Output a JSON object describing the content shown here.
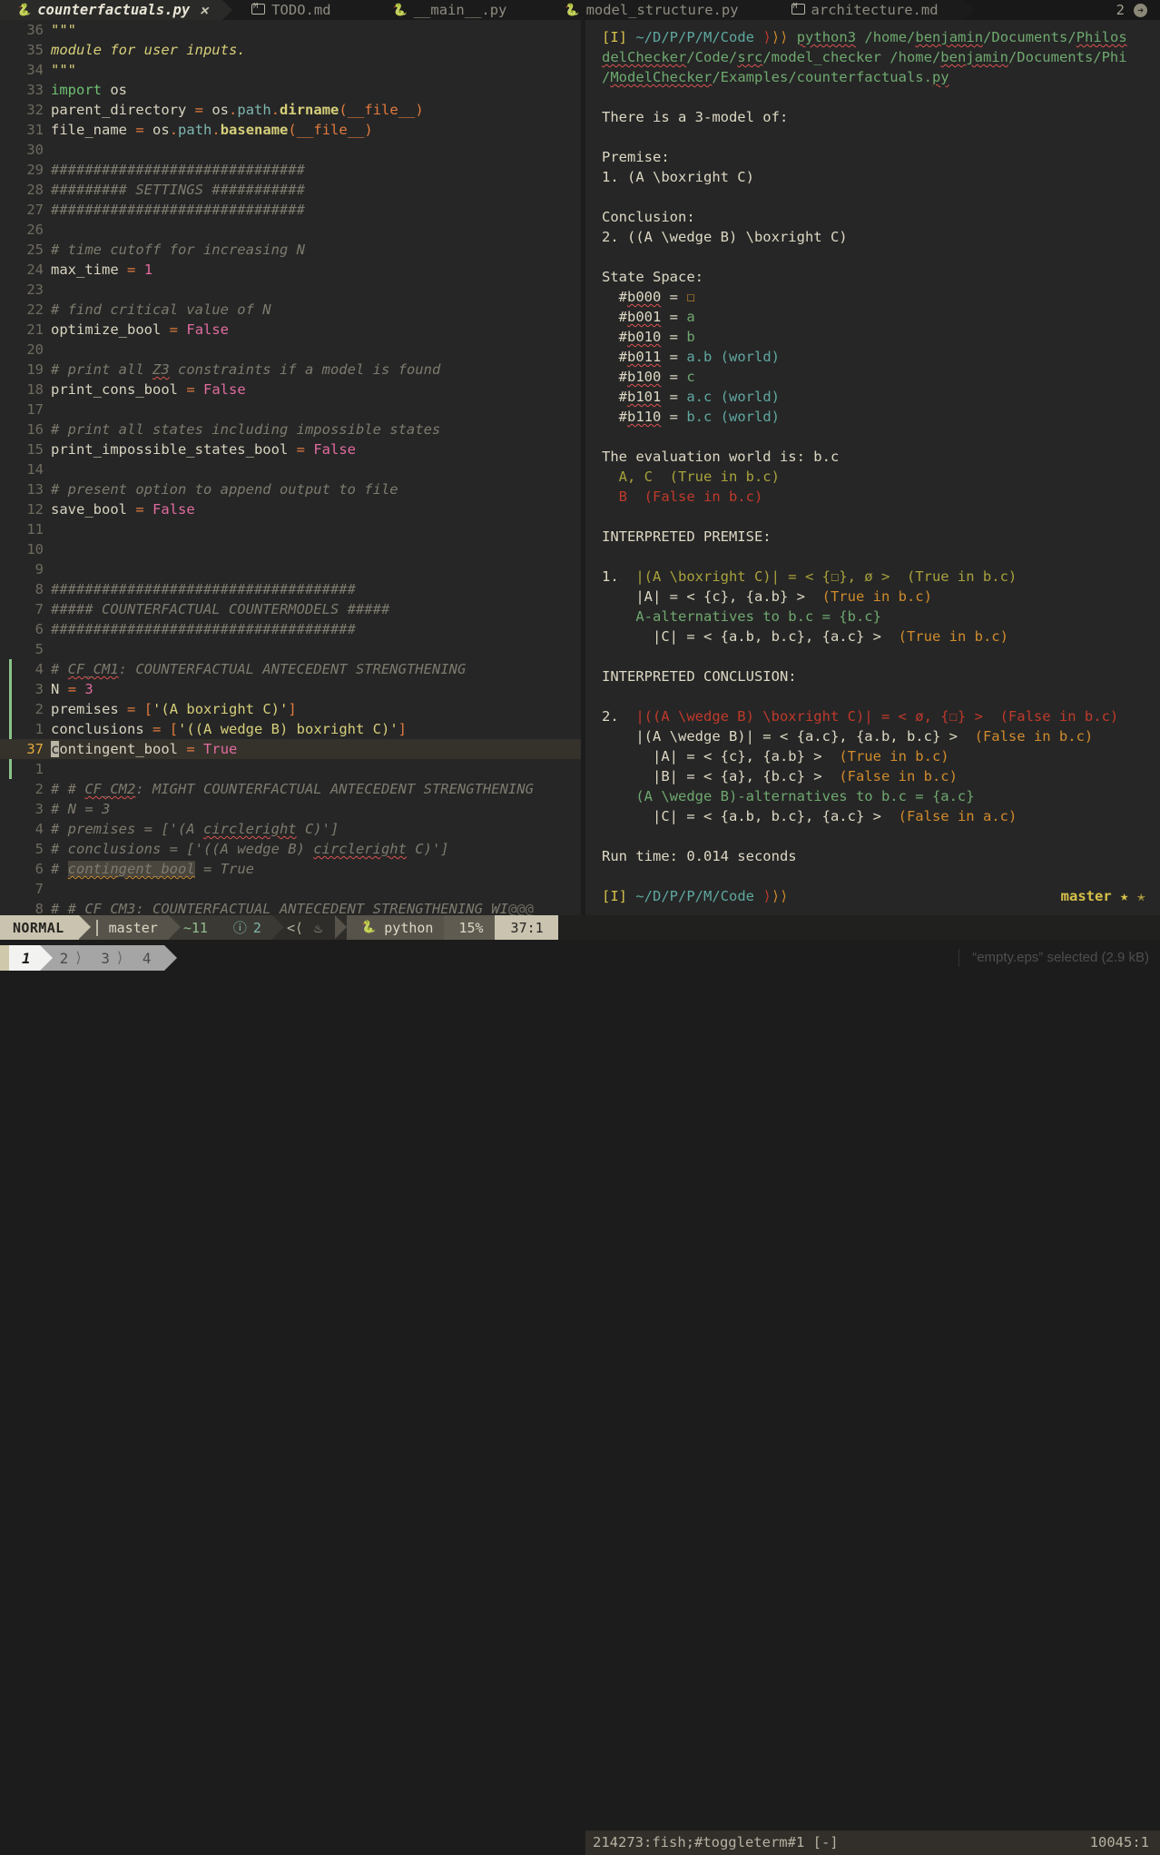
{
  "tabline": {
    "tabs": [
      {
        "label": "counterfactuals.py",
        "icon": "python-icon",
        "active": true,
        "closable": true
      },
      {
        "label": "TODO.md",
        "icon": "markdown-icon",
        "active": false
      },
      {
        "label": "__main__.py",
        "icon": "python-icon",
        "active": false
      },
      {
        "label": "model_structure.py",
        "icon": "python-icon",
        "active": false
      },
      {
        "label": "architecture.md",
        "icon": "markdown-icon",
        "active": false
      }
    ],
    "window_count": "2",
    "close_all_icon": "close-circle-icon"
  },
  "editor": {
    "lines": [
      {
        "num": "36",
        "html": "<span class=\"c-str\">\"\"\"</span>"
      },
      {
        "num": "35",
        "html": "<span class=\"c-str\" style=\"font-style:italic\">module for user inputs.</span>"
      },
      {
        "num": "34",
        "html": "<span class=\"c-str\">\"\"\"</span>"
      },
      {
        "num": "33",
        "html": "<span class=\"c-kw\">import</span> <span class=\"c-ident\">os</span>"
      },
      {
        "num": "32",
        "html": "<span class=\"c-ident\">parent_directory</span> <span class=\"c-op\">=</span> <span class=\"c-ident\">os</span><span class=\"c-op\">.</span><span class=\"c-attr\">path</span><span class=\"c-op\">.</span><span class=\"c-fn\">dirname</span><span class=\"c-brk\">(</span><span class=\"c-dunder\">__file__</span><span class=\"c-brk\">)</span>"
      },
      {
        "num": "31",
        "html": "<span class=\"c-ident\">file_name</span> <span class=\"c-op\">=</span> <span class=\"c-ident\">os</span><span class=\"c-op\">.</span><span class=\"c-attr\">path</span><span class=\"c-op\">.</span><span class=\"c-fn\">basename</span><span class=\"c-brk\">(</span><span class=\"c-dunder\">__file__</span><span class=\"c-brk\">)</span>"
      },
      {
        "num": "30",
        "html": ""
      },
      {
        "num": "29",
        "html": "<span class=\"c-comment\">##############################</span>"
      },
      {
        "num": "28",
        "html": "<span class=\"c-comment\">######### SETTINGS ###########</span>"
      },
      {
        "num": "27",
        "html": "<span class=\"c-comment\">##############################</span>"
      },
      {
        "num": "26",
        "html": ""
      },
      {
        "num": "25",
        "html": "<span class=\"c-comment\"># time cutoff for increasing N</span>"
      },
      {
        "num": "24",
        "html": "<span class=\"c-ident\">max_time</span> <span class=\"c-op\">=</span> <span class=\"c-num\">1</span>"
      },
      {
        "num": "23",
        "html": ""
      },
      {
        "num": "22",
        "html": "<span class=\"c-comment\"># find critical value of N</span>"
      },
      {
        "num": "21",
        "html": "<span class=\"c-ident\">optimize_bool</span> <span class=\"c-op\">=</span> <span class=\"c-bool\">False</span>"
      },
      {
        "num": "20",
        "html": ""
      },
      {
        "num": "19",
        "html": "<span class=\"c-comment\"># print all <span class=\"sq\">Z3</span> constraints if a model is found</span>"
      },
      {
        "num": "18",
        "html": "<span class=\"c-ident\">print_cons_bool</span> <span class=\"c-op\">=</span> <span class=\"c-bool\">False</span>"
      },
      {
        "num": "17",
        "html": ""
      },
      {
        "num": "16",
        "html": "<span class=\"c-comment\"># print all states including impossible states</span>"
      },
      {
        "num": "15",
        "html": "<span class=\"c-ident\">print_impossible_states_bool</span> <span class=\"c-op\">=</span> <span class=\"c-bool\">False</span>"
      },
      {
        "num": "14",
        "html": ""
      },
      {
        "num": "13",
        "html": "<span class=\"c-comment\"># present option to append output to file</span>"
      },
      {
        "num": "12",
        "html": "<span class=\"c-ident\">save_bool</span> <span class=\"c-op\">=</span> <span class=\"c-bool\">False</span>"
      },
      {
        "num": "11",
        "html": ""
      },
      {
        "num": "10",
        "html": ""
      },
      {
        "num": "9",
        "html": ""
      },
      {
        "num": "8",
        "html": "<span class=\"c-comment\">####################################</span>"
      },
      {
        "num": "7",
        "html": "<span class=\"c-comment\">##### COUNTERFACTUAL COUNTERMODELS #####</span>"
      },
      {
        "num": "6",
        "html": "<span class=\"c-comment\">####################################</span>"
      },
      {
        "num": "5",
        "html": ""
      },
      {
        "num": "4",
        "html": "<span class=\"c-comment\"># <span class=\"sq\">CF_CM1</span>: COUNTERFACTUAL ANTECEDENT STRENGTHENING</span>",
        "git": true
      },
      {
        "num": "3",
        "html": "<span class=\"c-ident\">N</span> <span class=\"c-op\">=</span> <span class=\"c-num\">3</span>",
        "git": true
      },
      {
        "num": "2",
        "html": "<span class=\"c-ident\">premises</span> <span class=\"c-op\">=</span> <span class=\"c-brk\">[</span><span class=\"c-str\">'(A boxright C)'</span><span class=\"c-brk\">]</span>",
        "git": true
      },
      {
        "num": "1",
        "html": "<span class=\"c-ident\">conclusions</span> <span class=\"c-op\">=</span> <span class=\"c-brk\">[</span><span class=\"c-str\">'((A wedge B) boxright C)'</span><span class=\"c-brk\">]</span>",
        "git": true
      },
      {
        "num": "37",
        "cursor": true,
        "git": true,
        "html": "<span class=\"cursor-blk\">c</span><span class=\"c-ident\">ontingent_bool</span> <span class=\"c-op\">=</span> <span class=\"c-bool\">True</span>"
      },
      {
        "num": "1",
        "html": ""
      },
      {
        "num": "2",
        "html": "<span class=\"c-comment\"># # <span class=\"sq\">CF_CM2</span>: MIGHT COUNTERFACTUAL ANTECEDENT STRENGTHENING</span>"
      },
      {
        "num": "3",
        "html": "<span class=\"c-comment\"># N = 3</span>"
      },
      {
        "num": "4",
        "html": "<span class=\"c-comment\"># premises = ['(A <span class=\"sq\">circleright</span> C)']</span>"
      },
      {
        "num": "5",
        "html": "<span class=\"c-comment\"># conclusions = ['((A wedge B) <span class=\"sq\">circleright</span> C)']</span>"
      },
      {
        "num": "6",
        "html": "<span class=\"c-comment\"># <span class=\"hl-word sq-o\">contingent_bool</span> = True</span>"
      },
      {
        "num": "7",
        "html": ""
      },
      {
        "num": "8",
        "html": "<span class=\"c-comment\"># # <span class=\"sq\">CF_CM3</span>: COUNTERFACTUAL ANTECEDENT STRENGTHENING WI</span><span class=\"at3\">@@@</span>"
      }
    ]
  },
  "terminal": {
    "lines": [
      {
        "html": "<span class=\"t-yellow\">[I]</span> <span class=\"t-teal\">~/D/P/P/M/Code</span> <span class=\"t-arrow-r\">&#10217;</span><span class=\"t-arrow-o\">&#10217;&#10217;</span> <span class=\"t-green sq\">python3</span> <span class=\"t-green\">/home/<span class=\"sq\">benjamin</span>/Documents/<span class=\"sq\">Philos</span></span>"
      },
      {
        "html": "<span class=\"t-green\"><span class=\"sq\">delChecker</span>/Code/<span class=\"sq\">src</span>/model_checker /home/<span class=\"sq\">benjamin</span>/Documents/Phi</span>"
      },
      {
        "html": "<span class=\"t-green\">/<span class=\"sq\">ModelChecker</span>/Examples/counterfactuals.<span class=\"sq\">py</span></span>"
      },
      {
        "html": ""
      },
      {
        "html": "<span class=\"t-cream\">There is a 3-model of:</span>"
      },
      {
        "html": ""
      },
      {
        "html": "<span class=\"t-cream\">Premise:</span>"
      },
      {
        "html": "<span class=\"t-cream\">1. (A \\boxright C)</span>"
      },
      {
        "html": ""
      },
      {
        "html": "<span class=\"t-cream\">Conclusion:</span>"
      },
      {
        "html": "<span class=\"t-cream\">2. ((A \\wedge B) \\boxright C)</span>"
      },
      {
        "html": ""
      },
      {
        "html": "<span class=\"t-cream\">State Space:</span>"
      },
      {
        "html": "  <span class=\"t-cream\">#<span class=\"sq\">b000</span> = </span><span class=\"t-orange\">&#9744;</span>"
      },
      {
        "html": "  <span class=\"t-cream\">#<span class=\"sq\">b001</span> = </span><span class=\"t-green\">a</span>"
      },
      {
        "html": "  <span class=\"t-cream\">#<span class=\"sq\">b010</span> = </span><span class=\"t-green\">b</span>"
      },
      {
        "html": "  <span class=\"t-cream\">#<span class=\"sq\">b011</span> = </span><span class=\"t-teal\">a.b (world)</span>"
      },
      {
        "html": "  <span class=\"t-cream\">#<span class=\"sq\">b100</span> = </span><span class=\"t-green\">c</span>"
      },
      {
        "html": "  <span class=\"t-cream\">#<span class=\"sq\">b101</span> = </span><span class=\"t-teal\">a.c (world)</span>"
      },
      {
        "html": "  <span class=\"t-cream\">#<span class=\"sq\">b110</span> = </span><span class=\"t-teal\">b.c (world)</span>"
      },
      {
        "html": ""
      },
      {
        "html": "<span class=\"t-cream\">The evaluation world is: b.c</span>"
      },
      {
        "html": "  <span class=\"t-olive\">A, C  (True in b.c)</span>"
      },
      {
        "html": "  <span class=\"t-red\">B  (False in b.c)</span>"
      },
      {
        "html": ""
      },
      {
        "html": "<span class=\"t-cream\">INTERPRETED PREMISE:</span>"
      },
      {
        "html": ""
      },
      {
        "html": "<span class=\"t-cream\">1.  </span><span class=\"t-olive\">|(A \\boxright C)| = &lt; {&#9744;}, &oslash; &gt;  (True in b.c)</span>"
      },
      {
        "html": "    <span class=\"t-cream\">|A| = &lt; {c}, {a.b} &gt;  </span><span class=\"t-orange\">(True in b.c)</span>"
      },
      {
        "html": "    <span class=\"t-green\">A-alternatives to b.c = {b.c}</span>"
      },
      {
        "html": "      <span class=\"t-cream\">|C| = &lt; {a.b, b.c}, {a.c} &gt;  </span><span class=\"t-orange\">(True in b.c)</span>"
      },
      {
        "html": ""
      },
      {
        "html": "<span class=\"t-cream\">INTERPRETED CONCLUSION:</span>"
      },
      {
        "html": ""
      },
      {
        "html": "<span class=\"t-cream\">2.  </span><span class=\"t-red\">|((A \\wedge B) \\boxright C)| = &lt; &oslash;, {&#9744;} &gt;  (False in b.c)</span>"
      },
      {
        "html": "    <span class=\"t-cream\">|(A \\wedge B)| = &lt; {a.c}, {a.b, b.c} &gt;  </span><span class=\"t-orange\">(False in b.c)</span>"
      },
      {
        "html": "      <span class=\"t-cream\">|A| = &lt; {c}, {a.b} &gt;  </span><span class=\"t-orange\">(True in b.c)</span>"
      },
      {
        "html": "      <span class=\"t-cream\">|B| = &lt; {a}, {b.c} &gt;  </span><span class=\"t-orange\">(False in b.c)</span>"
      },
      {
        "html": "    <span class=\"t-green\">(A \\wedge B)-alternatives to b.c = {a.c}</span>"
      },
      {
        "html": "      <span class=\"t-cream\">|C| = &lt; {a.b, b.c}, {a.c} &gt;  </span><span class=\"t-orange\">(False in a.c)</span>"
      },
      {
        "html": ""
      },
      {
        "html": "<span class=\"t-cream\">Run time: 0.014 seconds</span>"
      },
      {
        "html": ""
      },
      {
        "html": "<span class=\"t-yellow\">[I]</span> <span class=\"t-teal\">~/D/P/P/M/Code</span> <span class=\"t-arrow-r\">&#10217;</span><span class=\"t-arrow-o\">&#10217;&#10217;</span>"
      }
    ],
    "prompt_right": "master ★ ✭",
    "status_left": "214273:fish;#toggleterm#1 [-]",
    "status_right": "10045:1"
  },
  "statusbar": {
    "mode": "NORMAL",
    "branch": "master",
    "branch_icon": "git-branch-icon",
    "diff_modified": "~11",
    "diagnostics_icon": "info-icon",
    "diagnostics": "2",
    "nav_left_icon": "<(",
    "flame_icon": "flame-icon",
    "filetype_icon": "python-icon",
    "filetype": "python",
    "progress": "15%",
    "position": "37:1"
  },
  "bottombar": {
    "tabs": [
      "1",
      "2",
      "3",
      "4"
    ],
    "active_index": 0,
    "file_status": "“empty.eps” selected  (2.9 kB)"
  },
  "colors": {
    "bg": "#262626",
    "tabline_bg": "#181818",
    "accent_yellow": "#e7c547",
    "git_add": "#8bc38b",
    "cursor": "#b9b4a4"
  }
}
